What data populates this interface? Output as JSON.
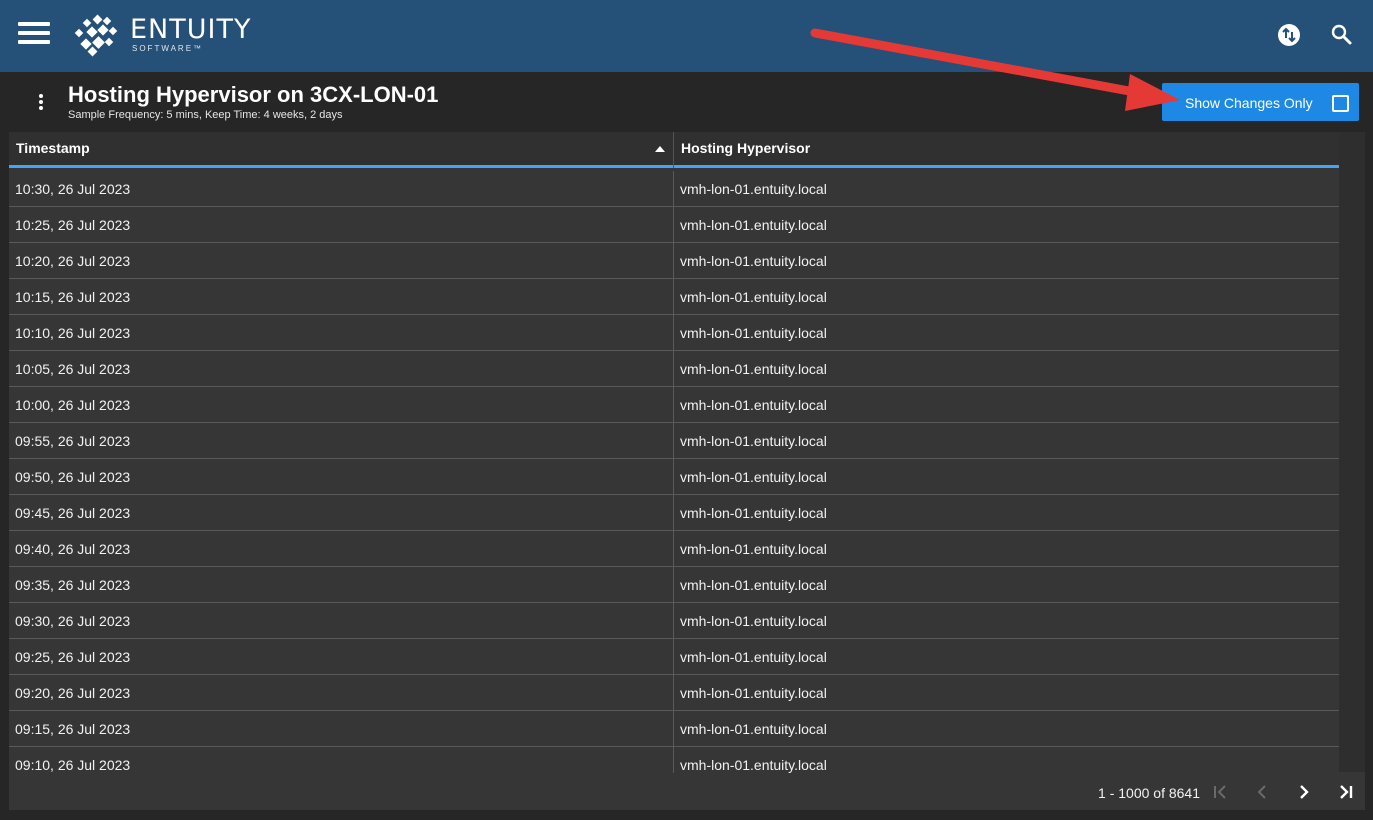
{
  "app": {
    "logo_name": "ENTUITY",
    "logo_sub": "SOFTWARE™",
    "icons": {
      "menu": "hamburger-icon",
      "swap": "swap-icon",
      "search": "search-icon"
    }
  },
  "header": {
    "title": "Hosting Hypervisor on 3CX-LON-01",
    "subtitle": "Sample Frequency: 5 mins, Keep Time: 4 weeks, 2 days",
    "toggle_label": "Show Changes Only",
    "toggle_checked": false
  },
  "table": {
    "columns": [
      "Timestamp",
      "Hosting Hypervisor"
    ],
    "sort": {
      "column": "Timestamp",
      "direction": "ascending-icon"
    },
    "rows": [
      [
        "10:30, 26 Jul 2023",
        "vmh-lon-01.entuity.local"
      ],
      [
        "10:25, 26 Jul 2023",
        "vmh-lon-01.entuity.local"
      ],
      [
        "10:20, 26 Jul 2023",
        "vmh-lon-01.entuity.local"
      ],
      [
        "10:15, 26 Jul 2023",
        "vmh-lon-01.entuity.local"
      ],
      [
        "10:10, 26 Jul 2023",
        "vmh-lon-01.entuity.local"
      ],
      [
        "10:05, 26 Jul 2023",
        "vmh-lon-01.entuity.local"
      ],
      [
        "10:00, 26 Jul 2023",
        "vmh-lon-01.entuity.local"
      ],
      [
        "09:55, 26 Jul 2023",
        "vmh-lon-01.entuity.local"
      ],
      [
        "09:50, 26 Jul 2023",
        "vmh-lon-01.entuity.local"
      ],
      [
        "09:45, 26 Jul 2023",
        "vmh-lon-01.entuity.local"
      ],
      [
        "09:40, 26 Jul 2023",
        "vmh-lon-01.entuity.local"
      ],
      [
        "09:35, 26 Jul 2023",
        "vmh-lon-01.entuity.local"
      ],
      [
        "09:30, 26 Jul 2023",
        "vmh-lon-01.entuity.local"
      ],
      [
        "09:25, 26 Jul 2023",
        "vmh-lon-01.entuity.local"
      ],
      [
        "09:20, 26 Jul 2023",
        "vmh-lon-01.entuity.local"
      ],
      [
        "09:15, 26 Jul 2023",
        "vmh-lon-01.entuity.local"
      ],
      [
        "09:10, 26 Jul 2023",
        "vmh-lon-01.entuity.local"
      ]
    ]
  },
  "pager": {
    "range": "1 - 1000 of 8641",
    "icons": [
      "first-page-icon",
      "previous-page-icon",
      "next-page-icon",
      "last-page-icon"
    ]
  },
  "colors": {
    "topbar": "#255078",
    "accent": "#1e88e5",
    "annotation_arrow": "#e53935"
  }
}
